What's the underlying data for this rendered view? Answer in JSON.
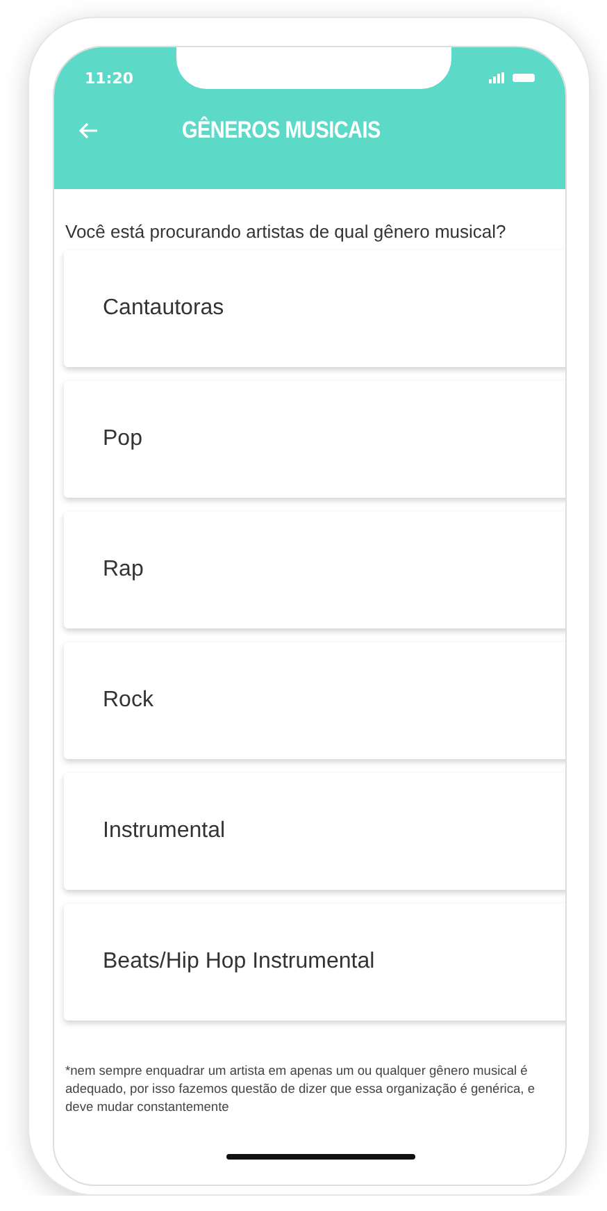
{
  "status_bar": {
    "time": "11:20"
  },
  "header": {
    "title": "GÊNEROS MUSICAIS"
  },
  "question": "Você está procurando artistas de qual gênero musical?",
  "genres": [
    {
      "label": "Cantautoras"
    },
    {
      "label": "Pop"
    },
    {
      "label": "Rap"
    },
    {
      "label": "Rock"
    },
    {
      "label": "Instrumental"
    },
    {
      "label": "Beats/Hip Hop Instrumental"
    }
  ],
  "footnote": "*nem sempre enquadrar um artista em apenas um ou qualquer gênero musical é adequado, por isso fazemos questão de dizer que essa organização é genérica, e deve mudar constantemente"
}
